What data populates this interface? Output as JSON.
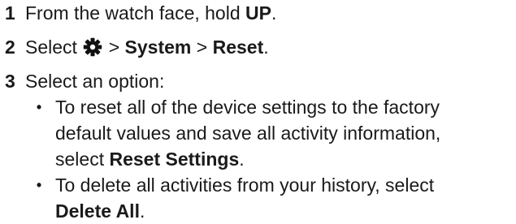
{
  "steps": [
    {
      "number": "1",
      "prefix": "From the watch face, hold ",
      "bold": "UP",
      "suffix": "."
    },
    {
      "number": "2",
      "prefix": "Select ",
      "icon": "gear-icon",
      "sep1": " > ",
      "menu1": "System",
      "sep2": " > ",
      "menu2": "Reset",
      "suffix": "."
    },
    {
      "number": "3",
      "text": "Select an option:"
    }
  ],
  "bullets": [
    {
      "marker": "•",
      "line1": "To reset all of the device settings to the factory",
      "line2": "default values and save all activity information,",
      "line3_prefix": "select ",
      "line3_bold": "Reset Settings",
      "line3_suffix": "."
    },
    {
      "marker": "•",
      "line1": "To delete all activities from your history, select",
      "line2_bold": "Delete All",
      "line2_suffix": "."
    }
  ]
}
